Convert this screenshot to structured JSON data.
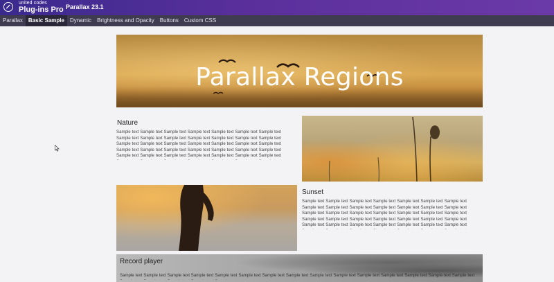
{
  "header": {
    "brand_small": "united codes",
    "brand_big": "Plug-ins Pro",
    "app_title": "Parallax 23.1"
  },
  "nav": {
    "tabs": [
      {
        "label": "Parallax",
        "active": false
      },
      {
        "label": "Basic Sample",
        "active": true
      },
      {
        "label": "Dynamic",
        "active": false
      },
      {
        "label": "Brightness and Opacity",
        "active": false
      },
      {
        "label": "Buttons",
        "active": false
      },
      {
        "label": "Custom CSS",
        "active": false
      }
    ]
  },
  "hero": {
    "title": "Parallax Regions"
  },
  "sections": {
    "nature": {
      "title": "Nature",
      "body": "Sample text Sample text Sample text Sample text Sample text Sample text Sample text Sample text Sample text Sample text Sample text Sample text Sample text Sample text Sample text Sample text Sample text Sample text Sample text Sample text Sample text Sample text Sample text Sample text Sample text Sample text Sample text Sample text Sample text Sample text Sample text Sample text Sample text Sample text Sample text Sample text Sample text Sample text Sample text Sample text Sample text Sample text Sample text Sample text Sample text Sample text Sample text Sample text Sample text Sample text Sample text Sample text Sample text Sample text Sample text Sample text Sample text Sample text Sample text Sample text"
    },
    "sunset": {
      "title": "Sunset",
      "body": "Sample text Sample text Sample text Sample text Sample text Sample text Sample text Sample text Sample text Sample text Sample text Sample text Sample text Sample text Sample text Sample text Sample text Sample text Sample text Sample text Sample text Sample text Sample text Sample text Sample text Sample text Sample text Sample text Sample text Sample text Sample text Sample text Sample text Sample text Sample text Sample text Sample text Sample text Sample text Sample text Sample text Sample text Sample text Sample text Sample text Sample text Sample text Sample text Sample text Sample text"
    },
    "record": {
      "title": "Record player",
      "body": "Sample text Sample text Sample text Sample text Sample text Sample text Sample text Sample text Sample text Sample text Sample text Sample text Sample text Sample text Sample text Sample text Sample text Sample text Sample text Sample text"
    }
  },
  "colors": {
    "header_gradient_start": "#3a2a8e",
    "header_gradient_end": "#6b3aa8",
    "nav_background": "#3f3b50",
    "page_background": "#f3f2f4"
  },
  "icons": {
    "logo": "united-codes-logo-icon",
    "cursor": "mouse-cursor-icon"
  }
}
